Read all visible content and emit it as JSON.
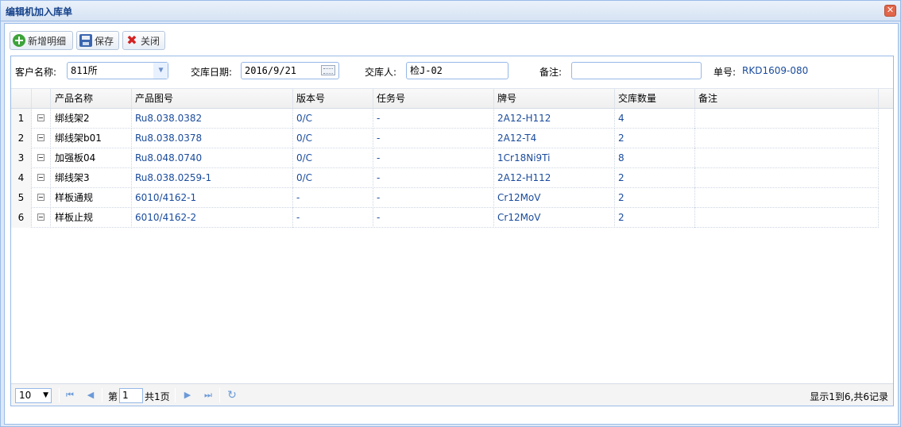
{
  "window": {
    "title": "编辑机加入库单",
    "close_glyph": "✕"
  },
  "toolbar": {
    "add_label": "新增明细",
    "save_label": "保存",
    "close_label": "关闭"
  },
  "form": {
    "customer_label": "客户名称:",
    "customer_value": "811所",
    "date_label": "交库日期:",
    "date_value": "2016/9/21",
    "person_label": "交库人:",
    "person_value": "检J-02",
    "remark_label": "备注:",
    "remark_value": "",
    "order_label": "单号:",
    "order_value": "RKD1609-080"
  },
  "grid": {
    "columns": [
      "产品名称",
      "产品图号",
      "版本号",
      "任务号",
      "牌号",
      "交库数量",
      "备注"
    ],
    "rows": [
      {
        "num": "1",
        "name": "绑线架2",
        "drawing": "Ru8.038.0382",
        "version": "0/C",
        "task": "-",
        "grade": "2A12-H112",
        "qty": "4",
        "remark": ""
      },
      {
        "num": "2",
        "name": "绑线架b01",
        "drawing": "Ru8.038.0378",
        "version": "0/C",
        "task": "-",
        "grade": "2A12-T4",
        "qty": "2",
        "remark": ""
      },
      {
        "num": "3",
        "name": "加强板04",
        "drawing": "Ru8.048.0740",
        "version": "0/C",
        "task": "-",
        "grade": "1Cr18Ni9Ti",
        "qty": "8",
        "remark": ""
      },
      {
        "num": "4",
        "name": "绑线架3",
        "drawing": "Ru8.038.0259-1",
        "version": "0/C",
        "task": "-",
        "grade": "2A12-H112",
        "qty": "2",
        "remark": ""
      },
      {
        "num": "5",
        "name": "样板通规",
        "drawing": "6010/4162-1",
        "version": "-",
        "task": "-",
        "grade": "Cr12MoV",
        "qty": "2",
        "remark": ""
      },
      {
        "num": "6",
        "name": "样板止规",
        "drawing": "6010/4162-2",
        "version": "-",
        "task": "-",
        "grade": "Cr12MoV",
        "qty": "2",
        "remark": ""
      }
    ]
  },
  "pager": {
    "page_size": "10",
    "page_prefix": "第",
    "page_value": "1",
    "page_total": "共1页",
    "info": "显示1到6,共6记录"
  },
  "colors": {
    "accent": "#99bbe8",
    "link_text": "#1a4b9c"
  },
  "icons": [
    "close-icon",
    "add-icon",
    "save-icon",
    "cancel-icon",
    "dropdown-arrow-icon",
    "calendar-icon",
    "collapse-icon",
    "first-page-icon",
    "prev-page-icon",
    "next-page-icon",
    "last-page-icon",
    "refresh-icon"
  ]
}
